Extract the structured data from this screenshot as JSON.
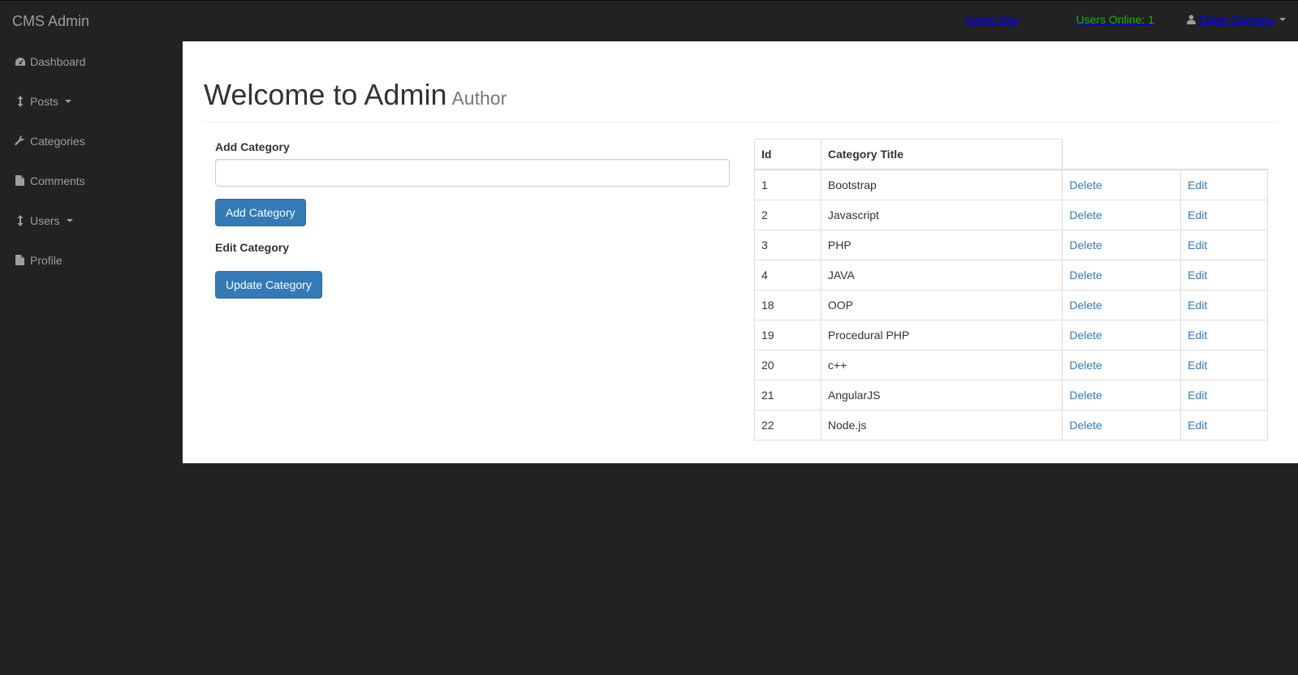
{
  "brand": "CMS Admin",
  "topnav": {
    "home": "Home Site",
    "users_online_label": "Users Online: ",
    "users_online_count": "1",
    "user": "Edem Dumenu"
  },
  "sidebar": {
    "items": [
      {
        "label": "Dashboard",
        "icon": "dashboard-icon"
      },
      {
        "label": "Posts",
        "icon": "arrows-v-icon",
        "dropdown": true
      },
      {
        "label": "Categories",
        "icon": "wrench-icon"
      },
      {
        "label": "Comments",
        "icon": "file-icon"
      },
      {
        "label": "Users",
        "icon": "arrows-v-icon",
        "dropdown": true
      },
      {
        "label": "Profile",
        "icon": "file-icon"
      }
    ]
  },
  "header": {
    "title": "Welcome to Admin",
    "subtitle": "Author"
  },
  "add_form": {
    "label": "Add Category",
    "value": "",
    "button": "Add Category"
  },
  "edit_form": {
    "label": "Edit Category",
    "button": "Update Category"
  },
  "table": {
    "headers": [
      "Id",
      "Category Title"
    ],
    "rows": [
      {
        "id": "1",
        "title": "Bootstrap",
        "delete": "Delete",
        "edit": "Edit"
      },
      {
        "id": "2",
        "title": "Javascript",
        "delete": "Delete",
        "edit": "Edit"
      },
      {
        "id": "3",
        "title": "PHP",
        "delete": "Delete",
        "edit": "Edit"
      },
      {
        "id": "4",
        "title": "JAVA",
        "delete": "Delete",
        "edit": "Edit"
      },
      {
        "id": "18",
        "title": "OOP",
        "delete": "Delete",
        "edit": "Edit"
      },
      {
        "id": "19",
        "title": "Procedural PHP",
        "delete": "Delete",
        "edit": "Edit"
      },
      {
        "id": "20",
        "title": "c++",
        "delete": "Delete",
        "edit": "Edit"
      },
      {
        "id": "21",
        "title": "AngularJS",
        "delete": "Delete",
        "edit": "Edit"
      },
      {
        "id": "22",
        "title": "Node.js",
        "delete": "Delete",
        "edit": "Edit"
      }
    ]
  },
  "colors": {
    "navbar_bg": "#222222",
    "nav_text": "#9d9d9d",
    "online_green": "#19b200",
    "link_blue": "#337ab7",
    "button_blue": "#337ab7"
  }
}
